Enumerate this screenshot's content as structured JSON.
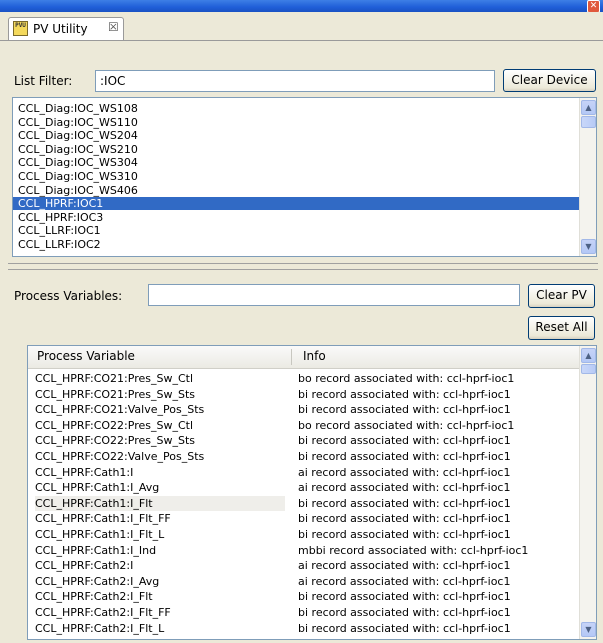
{
  "window": {
    "close_glyph": "✕"
  },
  "tab": {
    "icon_text": "PVU",
    "label": "PV Utility",
    "close_glyph": "☒"
  },
  "filter": {
    "label": "List Filter:",
    "value": ":IOC",
    "clear_label": "Clear Device"
  },
  "devices": {
    "items": [
      "CCL_Diag:IOC_WS108",
      "CCL_Diag:IOC_WS110",
      "CCL_Diag:IOC_WS204",
      "CCL_Diag:IOC_WS210",
      "CCL_Diag:IOC_WS304",
      "CCL_Diag:IOC_WS310",
      "CCL_Diag:IOC_WS406",
      "CCL_HPRF:IOC1",
      "CCL_HPRF:IOC3",
      "CCL_LLRF:IOC1",
      "CCL_LLRF:IOC2"
    ],
    "selected_index": 7
  },
  "pv": {
    "label": "Process Variables:",
    "value": "",
    "clear_label": "Clear PV",
    "reset_label": "Reset All"
  },
  "table": {
    "headers": [
      "Process Variable",
      "Info"
    ],
    "rows": [
      [
        "CCL_HPRF:CO21:Pres_Sw_Ctl",
        "bo record associated with: ccl-hprf-ioc1"
      ],
      [
        "CCL_HPRF:CO21:Pres_Sw_Sts",
        "bi record associated with: ccl-hprf-ioc1"
      ],
      [
        "CCL_HPRF:CO21:Valve_Pos_Sts",
        "bi record associated with: ccl-hprf-ioc1"
      ],
      [
        "CCL_HPRF:CO22:Pres_Sw_Ctl",
        "bo record associated with: ccl-hprf-ioc1"
      ],
      [
        "CCL_HPRF:CO22:Pres_Sw_Sts",
        "bi record associated with: ccl-hprf-ioc1"
      ],
      [
        "CCL_HPRF:CO22:Valve_Pos_Sts",
        "bi record associated with: ccl-hprf-ioc1"
      ],
      [
        "CCL_HPRF:Cath1:I",
        "ai record associated with: ccl-hprf-ioc1"
      ],
      [
        "CCL_HPRF:Cath1:I_Avg",
        "ai record associated with: ccl-hprf-ioc1"
      ],
      [
        "CCL_HPRF:Cath1:I_Flt",
        "bi record associated with: ccl-hprf-ioc1"
      ],
      [
        "CCL_HPRF:Cath1:I_Flt_FF",
        "bi record associated with: ccl-hprf-ioc1"
      ],
      [
        "CCL_HPRF:Cath1:I_Flt_L",
        "bi record associated with: ccl-hprf-ioc1"
      ],
      [
        "CCL_HPRF:Cath1:I_Ind",
        "mbbi record associated with: ccl-hprf-ioc1"
      ],
      [
        "CCL_HPRF:Cath2:I",
        "ai record associated with: ccl-hprf-ioc1"
      ],
      [
        "CCL_HPRF:Cath2:I_Avg",
        "ai record associated with: ccl-hprf-ioc1"
      ],
      [
        "CCL_HPRF:Cath2:I_Flt",
        "bi record associated with: ccl-hprf-ioc1"
      ],
      [
        "CCL_HPRF:Cath2:I_Flt_FF",
        "bi record associated with: ccl-hprf-ioc1"
      ],
      [
        "CCL_HPRF:Cath2:I_Flt_L",
        "bi record associated with: ccl-hprf-ioc1"
      ]
    ],
    "highlighted_index": 8
  },
  "colors": {
    "selection": "#316ac5",
    "window_bg": "#ece9d8",
    "titlebar": "#1f5ed8"
  }
}
